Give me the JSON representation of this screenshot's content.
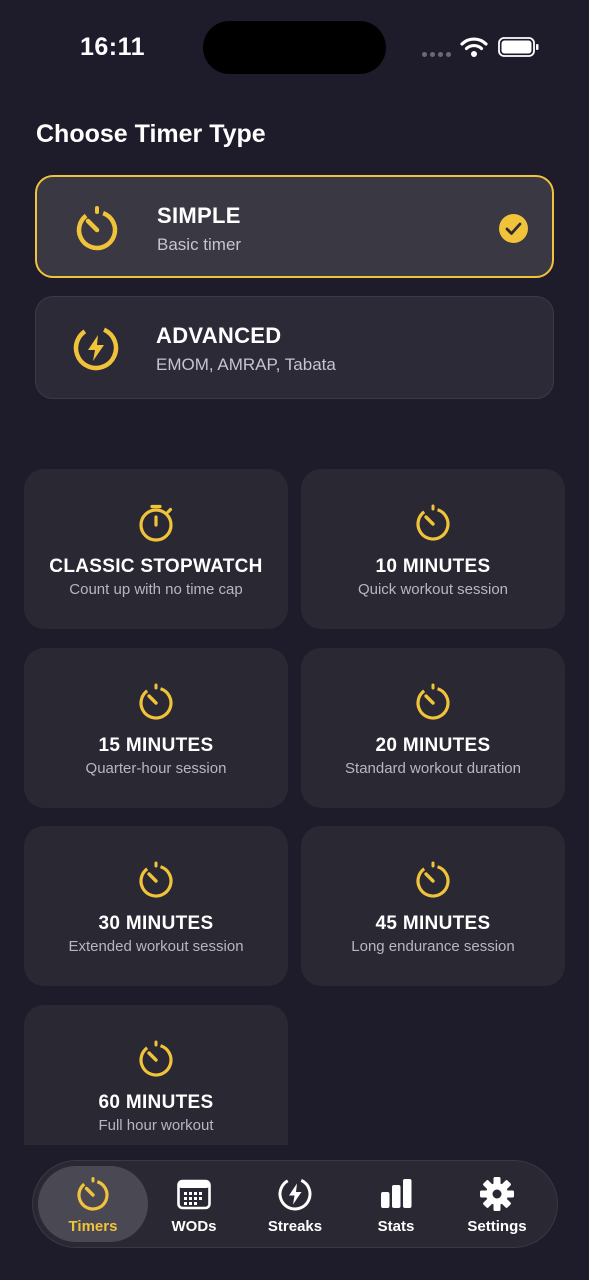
{
  "status_bar": {
    "time": "16:11"
  },
  "page_title": "Choose Timer Type",
  "accent_color": "#f0c33a",
  "timer_types": [
    {
      "id": "simple",
      "title": "SIMPLE",
      "subtitle": "Basic timer",
      "icon": "stopwatch-icon",
      "selected": true
    },
    {
      "id": "advanced",
      "title": "ADVANCED",
      "subtitle": "EMOM, AMRAP, Tabata",
      "icon": "lightning-icon",
      "selected": false
    }
  ],
  "timers": [
    {
      "title": "CLASSIC STOPWATCH",
      "subtitle": "Count up with no time cap",
      "icon": "stopwatch-icon"
    },
    {
      "title": "10 MINUTES",
      "subtitle": "Quick workout session",
      "icon": "timer-icon"
    },
    {
      "title": "15 MINUTES",
      "subtitle": "Quarter-hour session",
      "icon": "timer-icon"
    },
    {
      "title": "20 MINUTES",
      "subtitle": "Standard workout duration",
      "icon": "timer-icon"
    },
    {
      "title": "30 MINUTES",
      "subtitle": "Extended workout session",
      "icon": "timer-icon"
    },
    {
      "title": "45 MINUTES",
      "subtitle": "Long endurance session",
      "icon": "timer-icon"
    },
    {
      "title": "60 MINUTES",
      "subtitle": "Full hour workout",
      "icon": "timer-icon"
    }
  ],
  "tabs": [
    {
      "label": "Timers",
      "icon": "timer-icon",
      "active": true
    },
    {
      "label": "WODs",
      "icon": "calendar-icon",
      "active": false
    },
    {
      "label": "Streaks",
      "icon": "lightning-icon",
      "active": false
    },
    {
      "label": "Stats",
      "icon": "bar-chart-icon",
      "active": false
    },
    {
      "label": "Settings",
      "icon": "gear-icon",
      "active": false
    }
  ]
}
